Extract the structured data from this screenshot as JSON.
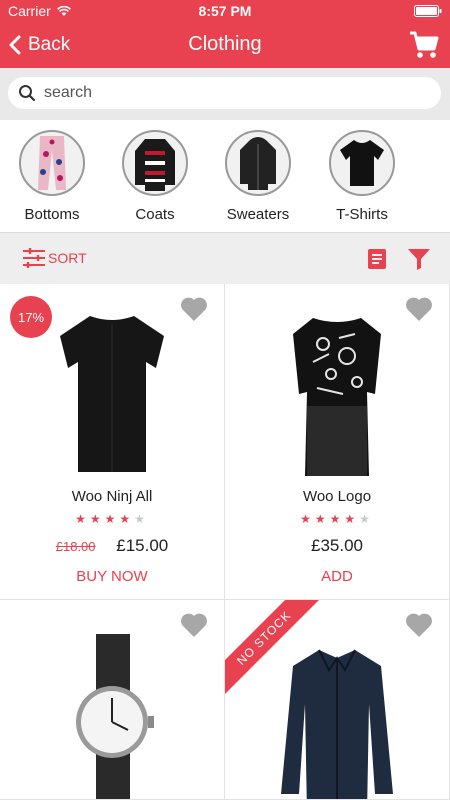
{
  "status": {
    "carrier": "Carrier",
    "time": "8:57 PM"
  },
  "header": {
    "back_label": "Back",
    "title": "Clothing"
  },
  "search": {
    "placeholder": "search"
  },
  "categories": [
    {
      "label": "Bottoms"
    },
    {
      "label": "Coats"
    },
    {
      "label": "Sweaters"
    },
    {
      "label": "T-Shirts"
    }
  ],
  "toolbar": {
    "sort_label": "SORT"
  },
  "products": [
    {
      "name": "Woo Ninj All",
      "old_price": "£18.00",
      "price": "£15.00",
      "cta": "BUY NOW",
      "badge": "17%",
      "rating": 4,
      "rating_max": 5
    },
    {
      "name": "Woo Logo",
      "price": "£35.00",
      "cta": "ADD",
      "rating": 4,
      "rating_max": 5
    },
    {
      "name": "",
      "price": "",
      "cta": ""
    },
    {
      "name": "",
      "price": "",
      "cta": "",
      "ribbon": "NO STOCK"
    }
  ],
  "colors": {
    "accent": "#e8414f",
    "searchbar_bg": "#e9e9e9",
    "sortbar_bg": "#eeeeee"
  }
}
